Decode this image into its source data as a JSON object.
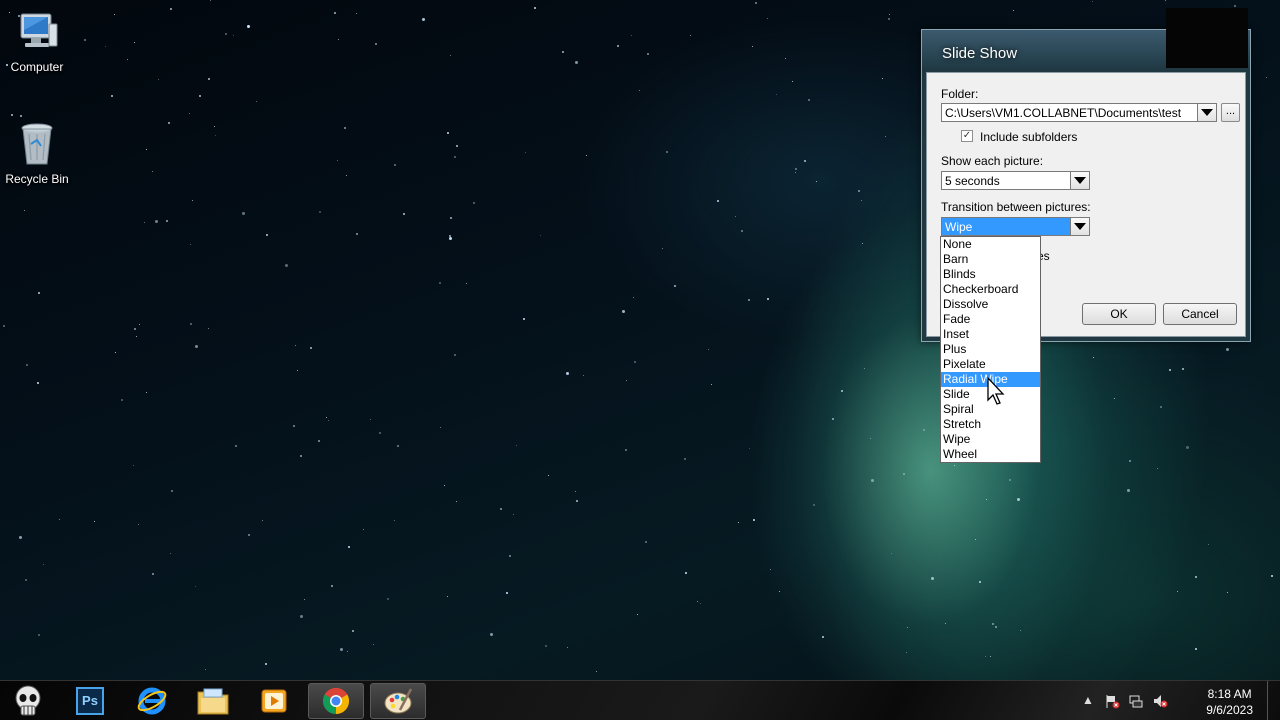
{
  "desktop": {
    "icons": [
      {
        "label": "Computer",
        "icon": "computer-icon"
      },
      {
        "label": "Recycle Bin",
        "icon": "recycle-bin-icon"
      }
    ]
  },
  "dialog": {
    "title": "Slide Show",
    "folder_label": "Folder:",
    "folder_value": "C:\\Users\\VM1.COLLABNET\\Documents\\test",
    "browse_label": "...",
    "include_subfolders_label": "Include subfolders",
    "include_subfolders_checked": true,
    "show_each_label": "Show each picture:",
    "show_each_value": "5 seconds",
    "transition_label": "Transition between pictures:",
    "transition_value": "Wipe",
    "partial_hidden_text": "es",
    "ok_label": "OK",
    "cancel_label": "Cancel"
  },
  "transition_options": [
    "None",
    "Barn",
    "Blinds",
    "Checkerboard",
    "Dissolve",
    "Fade",
    "Inset",
    "Plus",
    "Pixelate",
    "Radial Wipe",
    "Slide",
    "Spiral",
    "Stretch",
    "Wipe",
    "Wheel"
  ],
  "highlighted_option": "Radial Wipe",
  "taskbar": {
    "items": [
      {
        "name": "punisher-skull-icon",
        "active": false
      },
      {
        "name": "photoshop-icon",
        "active": false
      },
      {
        "name": "internet-explorer-icon",
        "active": false
      },
      {
        "name": "file-explorer-icon",
        "active": false
      },
      {
        "name": "media-player-icon",
        "active": false
      },
      {
        "name": "chrome-icon",
        "active": true
      },
      {
        "name": "paint-icon",
        "active": true
      }
    ],
    "photoshop_text": "Ps",
    "clock_time": "8:18 AM",
    "clock_date": "9/6/2023"
  },
  "colors": {
    "highlight": "#3399ff",
    "dialog_frame": "#26424f"
  }
}
